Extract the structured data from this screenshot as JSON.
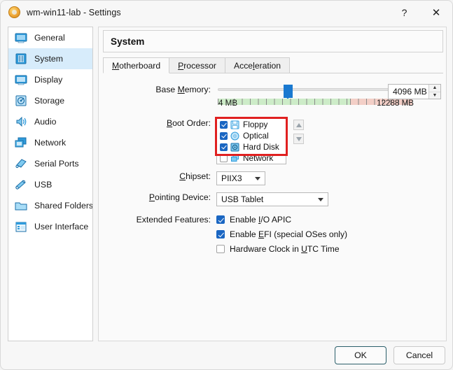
{
  "window": {
    "title": "wm-win11-lab - Settings",
    "app_icon": "virtualbox-icon",
    "help_label": "?",
    "close_label": "✕"
  },
  "sidebar": {
    "items": [
      {
        "label": "General",
        "icon": "general-monitor-icon",
        "selected": false
      },
      {
        "label": "System",
        "icon": "system-chip-icon",
        "selected": true
      },
      {
        "label": "Display",
        "icon": "display-monitor-icon",
        "selected": false
      },
      {
        "label": "Storage",
        "icon": "storage-disk-icon",
        "selected": false
      },
      {
        "label": "Audio",
        "icon": "audio-speaker-icon",
        "selected": false
      },
      {
        "label": "Network",
        "icon": "network-cards-icon",
        "selected": false
      },
      {
        "label": "Serial Ports",
        "icon": "serial-ports-icon",
        "selected": false
      },
      {
        "label": "USB",
        "icon": "usb-plug-icon",
        "selected": false
      },
      {
        "label": "Shared Folders",
        "icon": "shared-folder-icon",
        "selected": false
      },
      {
        "label": "User Interface",
        "icon": "user-interface-window-icon",
        "selected": false
      }
    ]
  },
  "panel": {
    "title": "System",
    "tabs": [
      {
        "label": "Motherboard",
        "accel": "M",
        "active": true
      },
      {
        "label": "Processor",
        "accel": "P",
        "active": false
      },
      {
        "label": "Acceleration",
        "accel": "l",
        "active": false
      }
    ]
  },
  "base_memory": {
    "label": "Base Memory:",
    "value": "4096 MB",
    "min_label": "4 MB",
    "max_label": "12288 MB",
    "handle_percent": 34,
    "green_percent": 68,
    "spin_up": "▲",
    "spin_down": "▼"
  },
  "boot_order": {
    "label": "Boot Order:",
    "highlight_color": "#e02020",
    "items": [
      {
        "name": "Floppy",
        "checked": true,
        "icon": "floppy-disk-icon",
        "highlighted": true
      },
      {
        "name": "Optical",
        "checked": true,
        "icon": "optical-disc-icon",
        "highlighted": true
      },
      {
        "name": "Hard Disk",
        "checked": true,
        "icon": "hard-disk-icon",
        "highlighted": true
      },
      {
        "name": "Network",
        "checked": false,
        "icon": "network-boot-icon",
        "highlighted": false
      }
    ],
    "move_up_title": "Move Up",
    "move_down_title": "Move Down"
  },
  "chipset": {
    "label": "Chipset:",
    "accel": "C",
    "value": "PIIX3"
  },
  "pointing_device": {
    "label": "Pointing Device:",
    "accel": "P",
    "value": "USB Tablet"
  },
  "extended_features": {
    "label": "Extended Features:",
    "items": [
      {
        "text_before": "Enable ",
        "accel": "I",
        "text_after": "/O APIC",
        "checked": true
      },
      {
        "text_before": "Enable ",
        "accel": "E",
        "text_after": "FI (special OSes only)",
        "checked": true
      },
      {
        "text_before": "Hardware Clock in ",
        "accel": "U",
        "text_after": "TC Time",
        "checked": false
      }
    ]
  },
  "footer": {
    "ok_label": "OK",
    "cancel_label": "Cancel"
  }
}
